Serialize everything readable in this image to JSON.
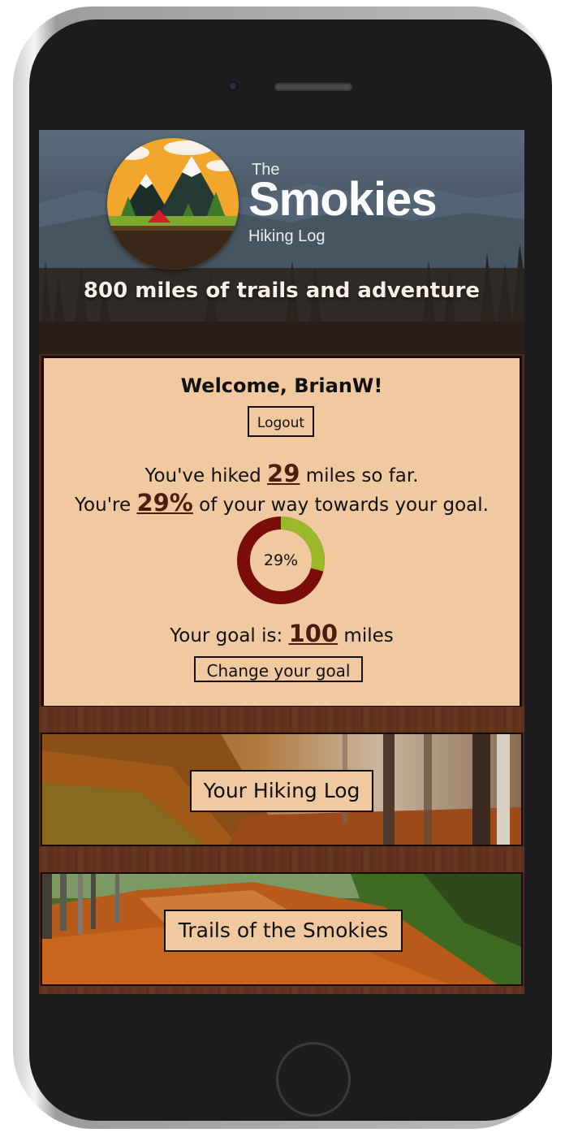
{
  "header": {
    "logo_the": "The",
    "logo_name": "Smokies",
    "logo_subtitle": "Hiking Log",
    "tagline": "800 miles of trails and adventure"
  },
  "account": {
    "welcome": "Welcome, BrianW!",
    "logout_label": "Logout"
  },
  "progress": {
    "hiked_prefix": "You've hiked",
    "hiked_miles": "29",
    "hiked_suffix": "miles so far.",
    "pct_prefix": "You're",
    "pct_value": "29%",
    "pct_suffix": "of your way towards your goal.",
    "donut_label": "29%",
    "donut_fraction": 0.29,
    "goal_prefix": "Your goal is:",
    "goal_miles": "100",
    "goal_suffix": "miles",
    "change_goal_label": "Change your goal"
  },
  "nav": {
    "hiking_log_label": "Your Hiking Log",
    "trails_label": "Trails of the Smokies"
  },
  "colors": {
    "panel_bg": "#f1c9a0",
    "donut_progress": "#9bb82a",
    "donut_track": "#7a0d0a",
    "accent_text": "#4a1f10"
  }
}
